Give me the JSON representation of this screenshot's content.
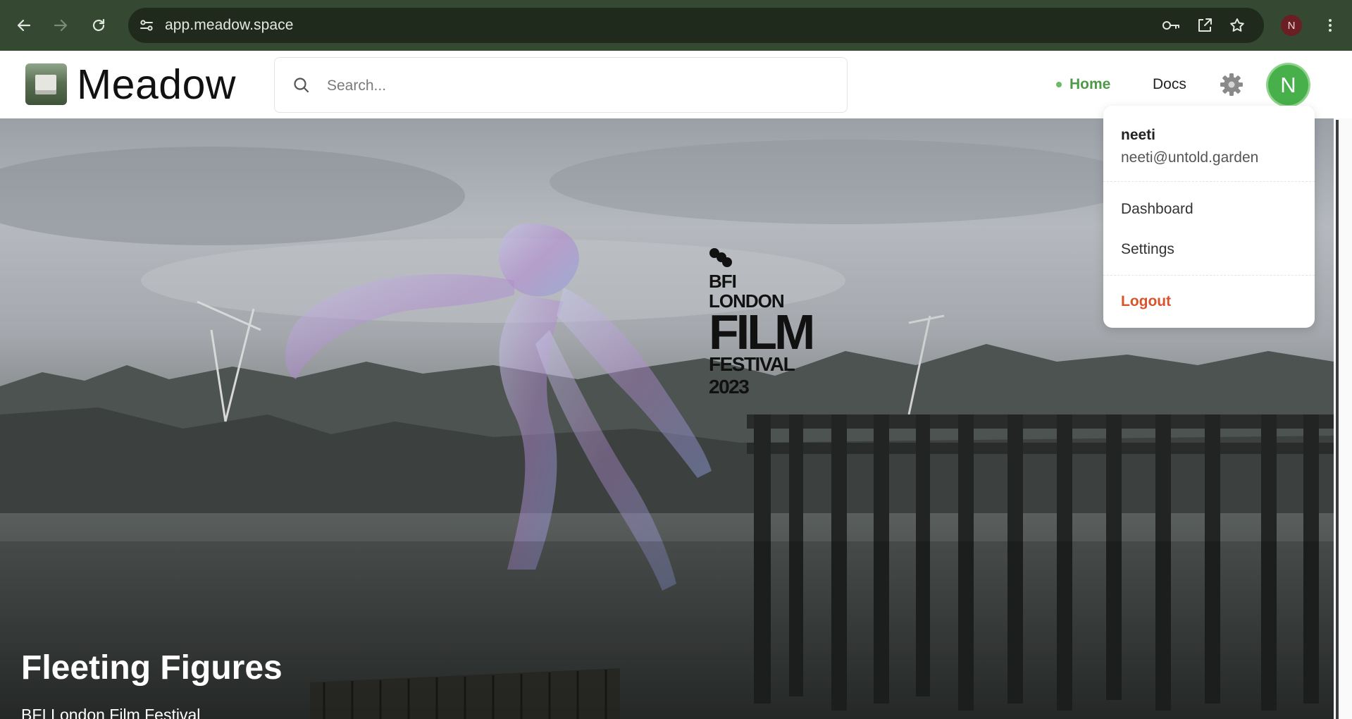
{
  "browser": {
    "url": "app.meadow.space",
    "profile_initial": "N"
  },
  "header": {
    "brand": "Meadow",
    "search_placeholder": "Search...",
    "nav_home": "Home",
    "nav_docs": "Docs",
    "avatar_initial": "N"
  },
  "user_menu": {
    "name": "neeti",
    "email": "neeti@untold.garden",
    "items": [
      "Dashboard",
      "Settings"
    ],
    "logout": "Logout"
  },
  "hero": {
    "title": "Fleeting Figures",
    "subtitle": "BFI London Film Festival",
    "poster_logo": {
      "line1": "BFI LONDON",
      "line2": "FILM",
      "line3": "FESTIVAL 2023"
    }
  },
  "colors": {
    "chrome_bg": "#354832",
    "omnibox_bg": "#1f2a1d",
    "accent_green": "#4f9a48",
    "avatar_green": "#47b04a",
    "logout_orange": "#d9532b"
  }
}
